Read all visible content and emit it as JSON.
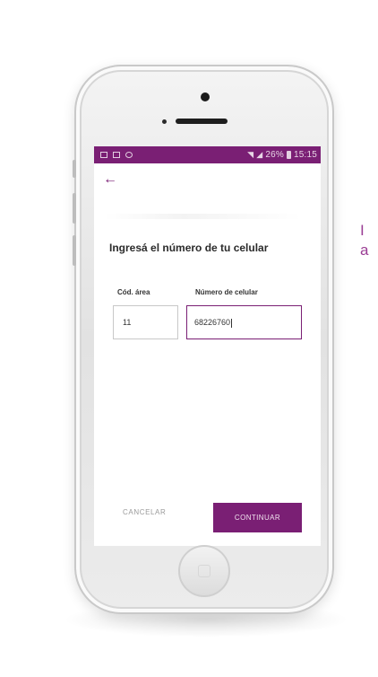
{
  "status_bar": {
    "right_text": "26%",
    "time": "15:15"
  },
  "screen": {
    "back_icon": "←",
    "heading": "Ingresá el número de tu celular",
    "area_label": "Cód. área",
    "area_value": "11",
    "number_label": "Número de celular",
    "number_value": "68226760",
    "cancel_label": "CANCELAR",
    "continue_label": "CONTINUAR"
  },
  "side_text": {
    "line1": "I",
    "line2": "a"
  },
  "colors": {
    "accent": "#7a1f74",
    "side_text": "#9a3d94"
  }
}
